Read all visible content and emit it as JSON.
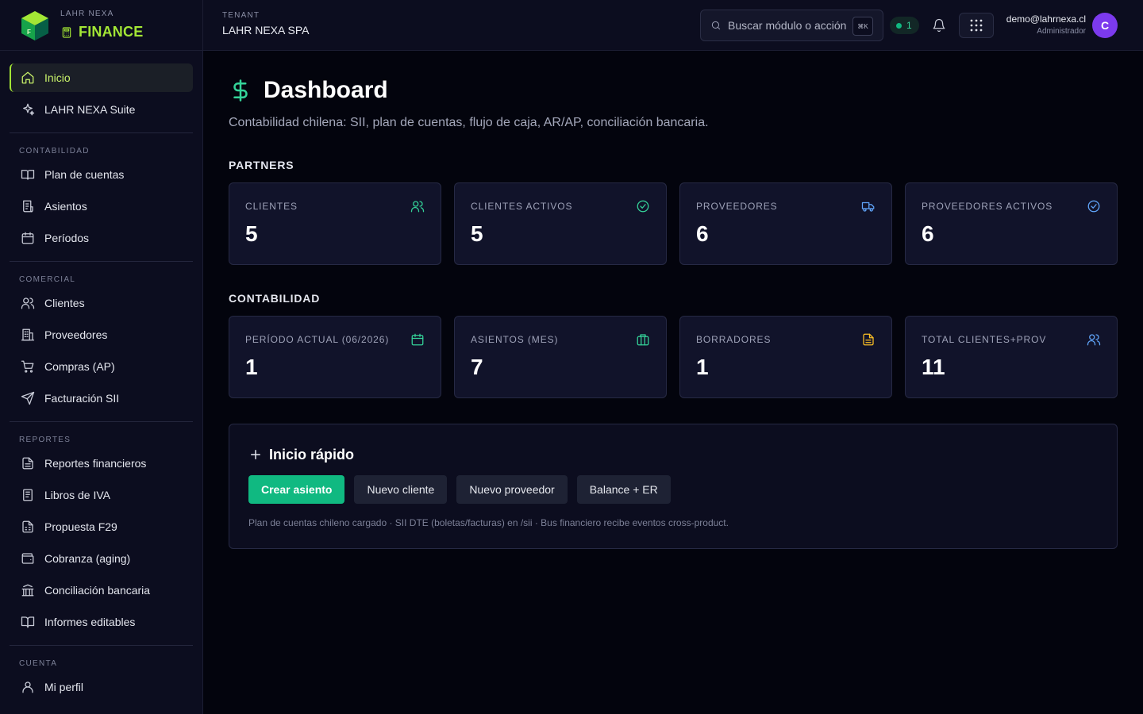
{
  "brand": {
    "company": "LAHR NEXA",
    "product": "FINANCE",
    "logo_letter": "F"
  },
  "sidebar": {
    "top_items": [
      {
        "label": "Inicio",
        "icon": "home-icon",
        "active": true
      },
      {
        "label": "LAHR NEXA Suite",
        "icon": "sparkle-icon"
      }
    ],
    "groups": [
      {
        "label": "CONTABILIDAD",
        "items": [
          {
            "label": "Plan de cuentas",
            "icon": "book-icon"
          },
          {
            "label": "Asientos",
            "icon": "receipt-icon"
          },
          {
            "label": "Períodos",
            "icon": "calendar-icon"
          }
        ]
      },
      {
        "label": "COMERCIAL",
        "items": [
          {
            "label": "Clientes",
            "icon": "users-icon"
          },
          {
            "label": "Proveedores",
            "icon": "building-icon"
          },
          {
            "label": "Compras (AP)",
            "icon": "cart-icon"
          },
          {
            "label": "Facturación SII",
            "icon": "send-icon"
          }
        ]
      },
      {
        "label": "REPORTES",
        "items": [
          {
            "label": "Reportes financieros",
            "icon": "file-text-icon"
          },
          {
            "label": "Libros de IVA",
            "icon": "notebook-icon"
          },
          {
            "label": "Propuesta F29",
            "icon": "file-spreadsheet-icon"
          },
          {
            "label": "Cobranza (aging)",
            "icon": "wallet-icon"
          },
          {
            "label": "Conciliación bancaria",
            "icon": "bank-icon"
          },
          {
            "label": "Informes editables",
            "icon": "book-open-icon"
          }
        ]
      },
      {
        "label": "CUENTA",
        "items": [
          {
            "label": "Mi perfil",
            "icon": "user-icon"
          }
        ]
      }
    ]
  },
  "topbar": {
    "tenant_label": "TENANT",
    "tenant_name": "LAHR NEXA SPA",
    "search_placeholder": "Buscar módulo o acción",
    "search_shortcut": "⌘K",
    "status_count": "1",
    "user_email": "demo@lahrnexa.cl",
    "user_role": "Administrador",
    "avatar_letter": "C"
  },
  "main": {
    "title": "Dashboard",
    "subtitle": "Contabilidad chilena: SII, plan de cuentas, flujo de caja, AR/AP, conciliación bancaria.",
    "partners": {
      "label": "PARTNERS",
      "cards": [
        {
          "label": "CLIENTES",
          "value": "5",
          "icon": "users-icon",
          "color": "#34d399"
        },
        {
          "label": "CLIENTES ACTIVOS",
          "value": "5",
          "icon": "check-circle-icon",
          "color": "#34d399"
        },
        {
          "label": "PROVEEDORES",
          "value": "6",
          "icon": "truck-icon",
          "color": "#60a5fa"
        },
        {
          "label": "PROVEEDORES ACTIVOS",
          "value": "6",
          "icon": "check-circle-icon",
          "color": "#60a5fa"
        }
      ]
    },
    "accounting": {
      "label": "CONTABILIDAD",
      "cards": [
        {
          "label": "PERÍODO ACTUAL (06/2026)",
          "value": "1",
          "icon": "calendar-icon",
          "color": "#34d399"
        },
        {
          "label": "ASIENTOS (MES)",
          "value": "7",
          "icon": "briefcase-icon",
          "color": "#34d399"
        },
        {
          "label": "BORRADORES",
          "value": "1",
          "icon": "file-text-icon",
          "color": "#fbbf24"
        },
        {
          "label": "TOTAL CLIENTES+PROV",
          "value": "11",
          "icon": "users-icon",
          "color": "#60a5fa"
        }
      ]
    },
    "quick_start": {
      "title": "Inicio rápido",
      "buttons": [
        "Crear asiento",
        "Nuevo cliente",
        "Nuevo proveedor",
        "Balance + ER"
      ],
      "note": "Plan de cuentas chileno cargado · SII DTE (boletas/facturas) en /sii · Bus financiero recibe eventos cross-product."
    }
  },
  "colors": {
    "accent": "#a3e635",
    "primary": "#10b981",
    "avatar": "#7c3aed"
  }
}
